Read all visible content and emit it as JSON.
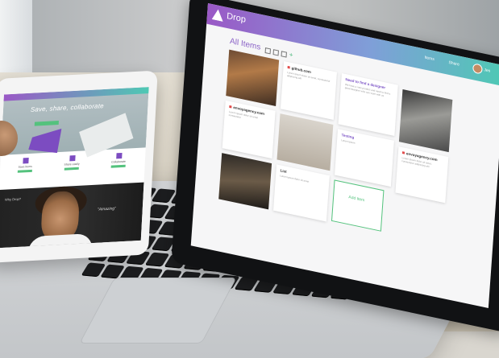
{
  "laptop_app": {
    "app_name": "Drop",
    "header_items": [
      "Items",
      "Share"
    ],
    "header_user": "Jes",
    "page_title": "All Items",
    "cards": [
      {
        "title": "github.com",
        "body": "Lorem ipsum dolor sit amet, consectetur adipiscing elit"
      },
      {
        "title": "Need to find a designer",
        "body": "We have a new product and need to find a great designer who can work with us"
      },
      {
        "title": "envoyagency.com",
        "body": "Lorem ipsum dolor sit amet consectetur"
      },
      {
        "title": "Testing",
        "body": "Lorem ipsum"
      },
      {
        "title": "envoyagency.com",
        "body": "Lorem ipsum dolor sit amet, consectetur adipiscing elit"
      },
      {
        "title": "List",
        "body": "Lorem ipsum dolor sit amet"
      }
    ],
    "add_label": "Add Item"
  },
  "tablet_site": {
    "slogan": "Save, share, collaborate",
    "features": [
      "Save items",
      "Share easily",
      "Collaborate"
    ],
    "caption": "Why Drop?",
    "quote": "“Amazing”"
  },
  "colors": {
    "brand_purple": "#9a58c6",
    "brand_teal": "#4ec9b4",
    "accent_green": "#54c27d",
    "card_red": "#e24a4a"
  }
}
